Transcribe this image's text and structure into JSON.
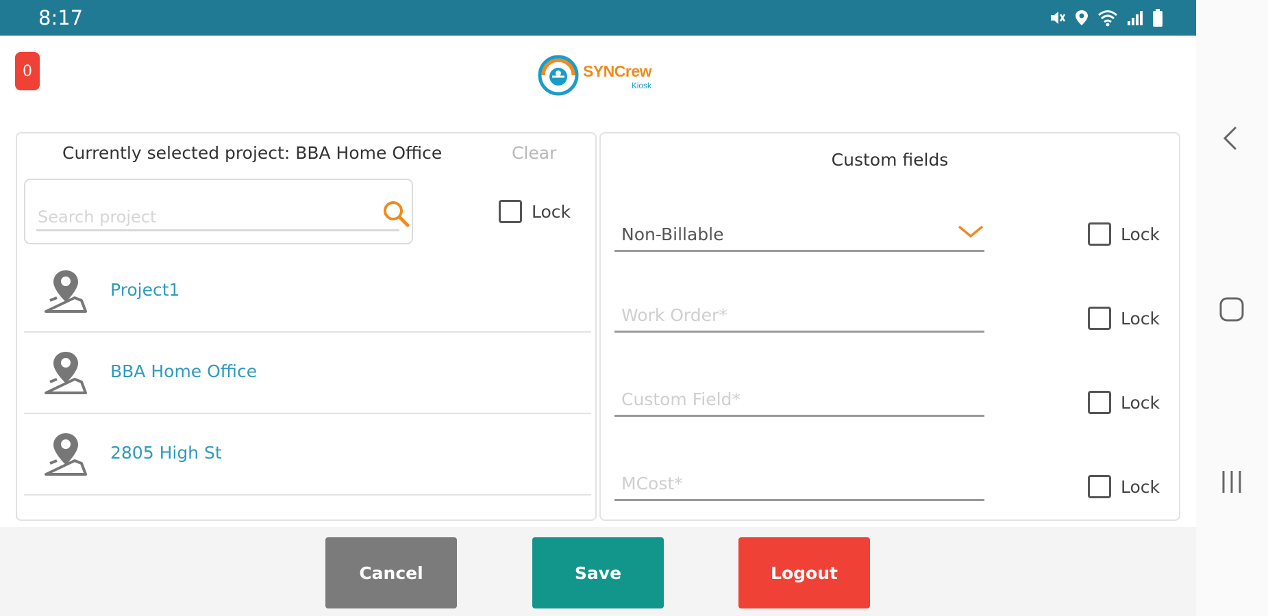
{
  "status_bar": {
    "time": "8:17",
    "icons": [
      "mute-icon",
      "location-icon",
      "wifi-icon",
      "signal-icon",
      "battery-icon"
    ],
    "background": "#217a94"
  },
  "header": {
    "badge_count": "0",
    "logo": {
      "name": "SYNCrew",
      "subtitle": "Kiosk"
    }
  },
  "project_panel": {
    "current_project_text": "Currently selected project: BBA Home Office",
    "clear_label": "Clear",
    "search_placeholder": "Search project",
    "lock_label": "Lock",
    "projects": [
      {
        "name": "Project1"
      },
      {
        "name": "BBA Home Office"
      },
      {
        "name": "2805 High St"
      }
    ]
  },
  "custom_fields_panel": {
    "title": "Custom fields",
    "fields": [
      {
        "type": "dropdown",
        "value": "Non-Billable",
        "lock_label": "Lock"
      },
      {
        "type": "text",
        "placeholder": "Work Order*",
        "lock_label": "Lock"
      },
      {
        "type": "text",
        "placeholder": "Custom Field*",
        "lock_label": "Lock"
      },
      {
        "type": "text",
        "placeholder": "MCost*",
        "lock_label": "Lock"
      }
    ]
  },
  "footer": {
    "cancel_label": "Cancel",
    "save_label": "Save",
    "logout_label": "Logout"
  },
  "navigation_bar": {
    "buttons": [
      "back-icon",
      "home-icon",
      "recents-icon"
    ]
  },
  "colors": {
    "accent_orange": "#f08a1c",
    "link_blue": "#2d9bbd",
    "save_teal": "#12968b",
    "danger_red": "#ef4136",
    "cancel_grey": "#7b7b7b"
  }
}
